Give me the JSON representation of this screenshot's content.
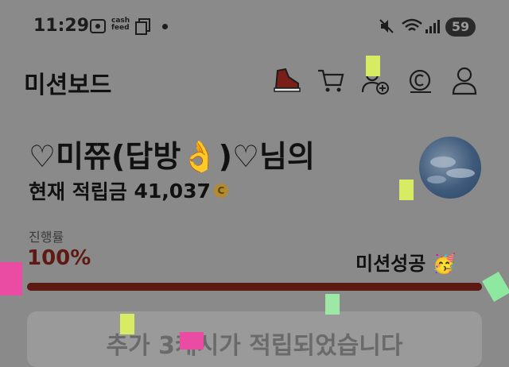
{
  "status_bar": {
    "time": "11:29",
    "cashfeed_line1": "cash",
    "cashfeed_line2": "feed",
    "battery": "59"
  },
  "header": {
    "title": "미션보드"
  },
  "user": {
    "name": "♡미쮸(답방👌)♡님의",
    "balance_label": "현재 적립금",
    "balance_value": "41,037",
    "coin_symbol": "C"
  },
  "progress": {
    "label": "진행률",
    "value_text": "100%",
    "fraction": 1.0,
    "status_text": "미션성공 🥳"
  },
  "notice": {
    "text": "추가 3캐시가 적립되었습니다"
  },
  "colors": {
    "background": "#8a8a8a",
    "accent_dark_red": "#5c1a12",
    "coin": "#b38a2e"
  },
  "icons": [
    "sneaker-icon",
    "cart-icon",
    "add-friend-icon",
    "coin-icon",
    "profile-icon"
  ]
}
